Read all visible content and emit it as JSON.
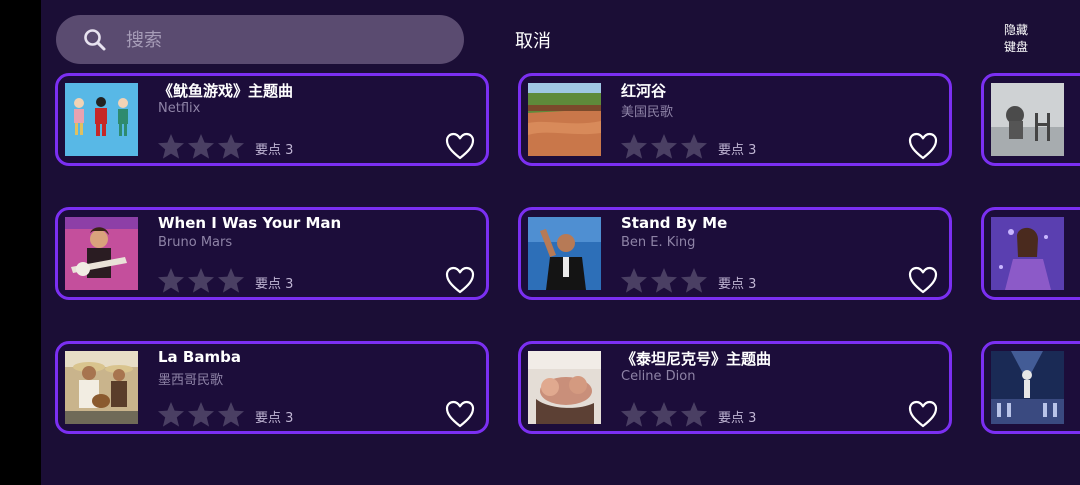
{
  "search": {
    "placeholder": "搜索",
    "value": ""
  },
  "header": {
    "cancel_label": "取消",
    "hide_keyboard_line1": "隐藏",
    "hide_keyboard_line2": "键盘"
  },
  "songs": [
    {
      "title": "《鱿鱼游戏》主题曲",
      "artist": "Netflix",
      "points_label": "要点 3",
      "rating": 0,
      "favorited": false
    },
    {
      "title": "红河谷",
      "artist": "美国民歌",
      "points_label": "要点 3",
      "rating": 0,
      "favorited": false
    },
    {
      "title": "When I Was Your Man",
      "artist": "Bruno Mars",
      "points_label": "要点 3",
      "rating": 0,
      "favorited": false
    },
    {
      "title": "Stand By Me",
      "artist": "Ben E. King",
      "points_label": "要点 3",
      "rating": 0,
      "favorited": false
    },
    {
      "title": "La Bamba",
      "artist": "墨西哥民歌",
      "points_label": "要点 3",
      "rating": 0,
      "favorited": false
    },
    {
      "title": "《泰坦尼克号》主题曲",
      "artist": "Celine Dion",
      "points_label": "要点 3",
      "rating": 0,
      "favorited": false
    }
  ],
  "colors": {
    "background": "#1b0e36",
    "card_border": "#7b2ff2",
    "search_bg": "#5a4b70",
    "star_empty": "#4a3f63"
  }
}
